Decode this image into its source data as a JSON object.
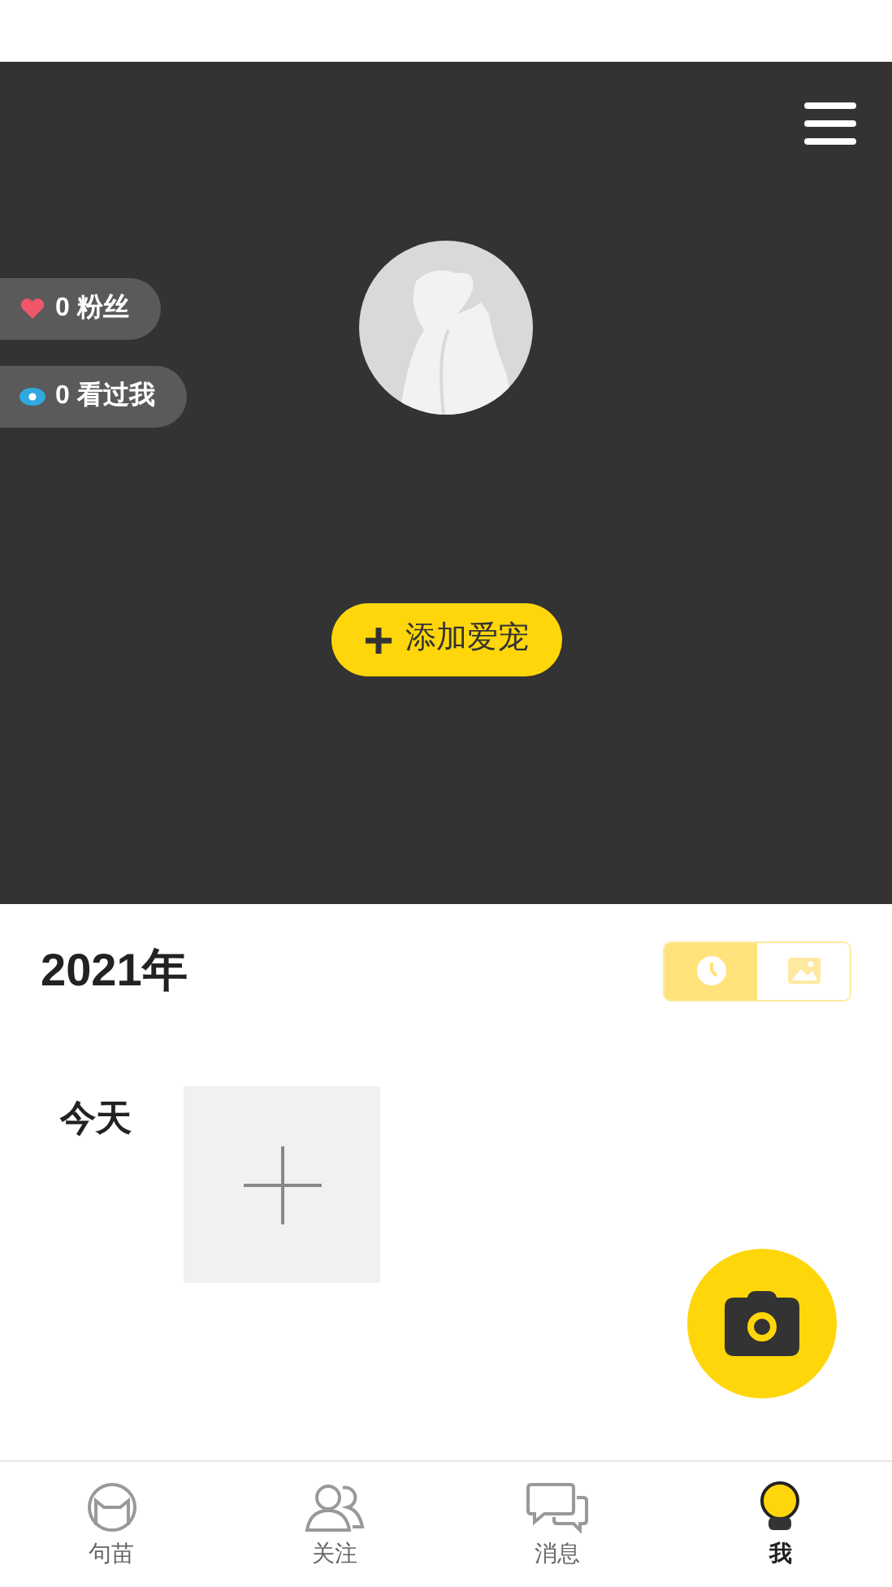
{
  "stats": [
    {
      "kind": "fans",
      "text": "0 粉丝"
    },
    {
      "kind": "views",
      "text": "0 看过我"
    }
  ],
  "add_pet_button": {
    "label": "添加爱宠"
  },
  "year": "2021年",
  "view_toggle": [
    {
      "kind": "timeline",
      "selected": true
    },
    {
      "kind": "gallery",
      "selected": false
    }
  ],
  "day_label": "今天",
  "tabs": [
    {
      "kind": "home",
      "label": "句苗",
      "selected": false
    },
    {
      "kind": "follow",
      "label": "关注",
      "selected": false
    },
    {
      "kind": "messages",
      "label": "消息",
      "selected": false
    },
    {
      "kind": "me",
      "label": "我",
      "selected": true
    }
  ]
}
